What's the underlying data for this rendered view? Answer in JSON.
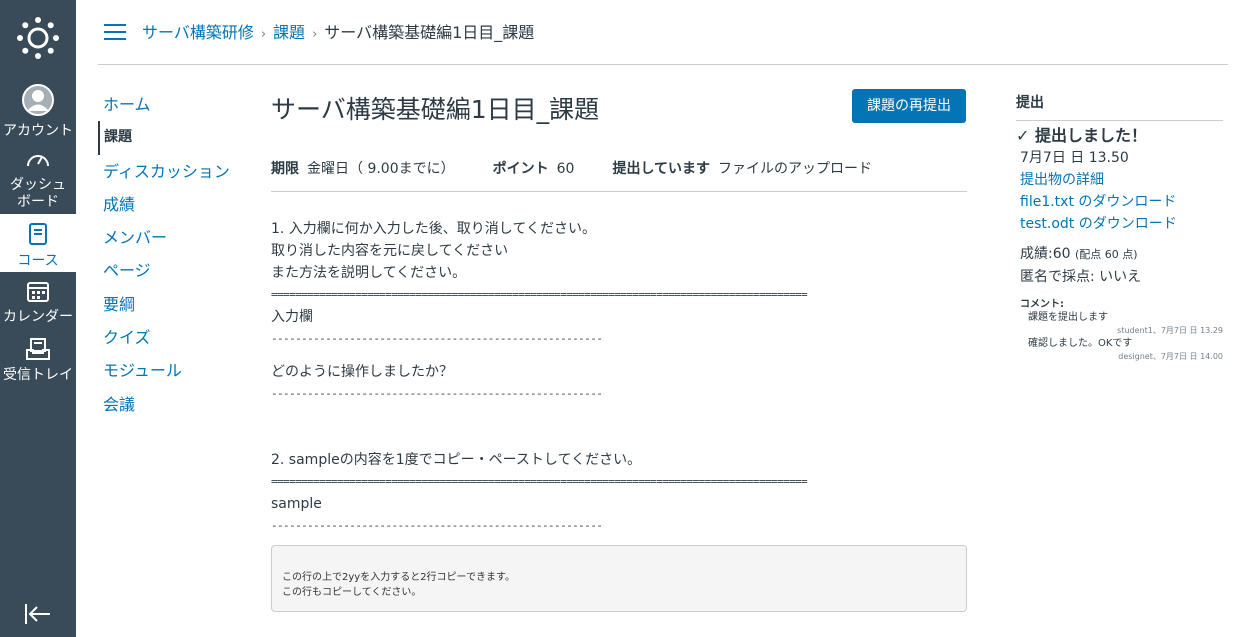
{
  "global_nav": {
    "items": [
      {
        "label": "アカウント",
        "icon": "user-avatar-icon"
      },
      {
        "label": "ダッシュボード",
        "label_lines": [
          "ダッシュ",
          "ボード"
        ],
        "icon": "dashboard-icon"
      },
      {
        "label": "コース",
        "icon": "courses-icon",
        "active": true
      },
      {
        "label": "カレンダー",
        "icon": "calendar-icon"
      },
      {
        "label": "受信トレイ",
        "icon": "inbox-icon"
      }
    ]
  },
  "breadcrumb": {
    "course": "サーバ構築研修",
    "section": "課題",
    "current": "サーバ構築基礎編1日目_課題"
  },
  "course_nav": {
    "items": [
      "ホーム",
      "課題",
      "ディスカッション",
      "成績",
      "メンバー",
      "ページ",
      "要綱",
      "クイズ",
      "モジュール",
      "会議"
    ],
    "active": "課題"
  },
  "assignment": {
    "title": "サーバ構築基礎編1日目_課題",
    "resubmit_label": "課題の再提出",
    "due_label": "期限",
    "due_value": "金曜日（ 9.00までに）",
    "points_label": "ポイント",
    "points_value": "60",
    "submitting_label": "提出しています",
    "submitting_value": "ファイルのアップロード",
    "description": {
      "q1_line1": "1. 入力欄に何か入力した後、取り消してください。",
      "q1_line2": "取り消した内容を元に戻してください",
      "q1_line3": "また方法を説明してください。",
      "rule_eq": "=========================================================================================",
      "input_label": "入力欄",
      "rule_dash": "-------------------------------------------------------",
      "q1_prompt": "どのように操作しましたか？",
      "q2_line1": "2. sampleの内容を1度でコピー・ペーストしてください。",
      "sample": "sample",
      "code_line1": "この行の上で2yyを入力すると2行コピーできます。",
      "code_line2": "この行もコピーしてください。"
    }
  },
  "submission": {
    "heading": "提出",
    "status": "提出しました！",
    "date": "7月7日 日 13.50",
    "details_link": "提出物の詳細",
    "download1": "file1.txt のダウンロード",
    "download2": "test.odt のダウンロード",
    "grade_label": "成績:60",
    "grade_note": "(配点 60 点)",
    "anonymous": "匿名で採点: いいえ",
    "comments_heading": "コメント:",
    "comments": [
      {
        "text": "課題を提出します",
        "meta": "student1、7月7日 日 13.29"
      },
      {
        "text": "確認しました。OKです",
        "meta": "designet、7月7日 日 14.00"
      }
    ]
  }
}
